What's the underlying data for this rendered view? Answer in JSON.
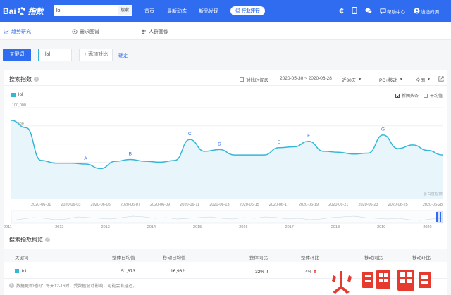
{
  "header": {
    "logo_text_left": "Bai",
    "logo_text_right": "指数",
    "search_value": "lol",
    "search_button": "搜索",
    "nav": [
      "首页",
      "最新动态",
      "新品发现"
    ],
    "rank_button": "行业排行",
    "tools": [
      {
        "icon": "share-icon",
        "label": ""
      },
      {
        "icon": "mobile-icon",
        "label": ""
      },
      {
        "icon": "wechat-icon",
        "label": ""
      },
      {
        "icon": "help-icon",
        "label": "帮助中心"
      },
      {
        "icon": "user-icon",
        "label": "浅浅的调"
      }
    ]
  },
  "subnav": {
    "items": [
      "趋势研究",
      "需求图谱",
      "人群画像"
    ]
  },
  "keyword_bar": {
    "keyword_button": "关键词",
    "keyword": "lol",
    "add_compare": "+ 添加对比",
    "confirm": "确定"
  },
  "chart_panel": {
    "title": "搜索指数",
    "compare_period": "对比时间段",
    "date_range": "2020-05-30 ~ 2020-06-28",
    "range_select": "近30天",
    "device_select": "PC+移动",
    "region_select": "全国",
    "news_label": "新闻头条",
    "avg_label": "平均值",
    "watermark": "@百度指数"
  },
  "chart_data": {
    "type": "area",
    "series": [
      {
        "name": "lol",
        "color": "#35b6d8"
      }
    ],
    "ylim": [
      0,
      100000
    ],
    "y_ticks": [
      "100,000",
      "80,000",
      "60,000",
      "40,000",
      "20,000"
    ],
    "x_tick_labels": [
      "2020-06-01",
      "2020-06-03",
      "2020-06-05",
      "2020-06-07",
      "2020-06-09",
      "2020-06-11",
      "2020-06-13",
      "2020-06-15",
      "2020-06-17",
      "2020-06-19",
      "2020-06-21",
      "2020-06-23",
      "2020-06-25",
      "2020-06-28"
    ],
    "x": [
      "2020-05-30",
      "2020-05-31",
      "2020-06-01",
      "2020-06-02",
      "2020-06-03",
      "2020-06-04",
      "2020-06-05",
      "2020-06-06",
      "2020-06-07",
      "2020-06-08",
      "2020-06-09",
      "2020-06-10",
      "2020-06-11",
      "2020-06-12",
      "2020-06-13",
      "2020-06-14",
      "2020-06-15",
      "2020-06-16",
      "2020-06-17",
      "2020-06-18",
      "2020-06-19",
      "2020-06-20",
      "2020-06-21",
      "2020-06-22",
      "2020-06-23",
      "2020-06-24",
      "2020-06-25",
      "2020-06-26",
      "2020-06-27",
      "2020-06-28"
    ],
    "values": [
      86000,
      78000,
      42000,
      39000,
      39000,
      38000,
      33000,
      41000,
      43000,
      41000,
      40000,
      42000,
      65000,
      52000,
      54000,
      48000,
      48000,
      48000,
      56000,
      57000,
      63000,
      52000,
      51000,
      49000,
      50000,
      70000,
      55000,
      59000,
      53000,
      48000
    ],
    "annotations": [
      {
        "label": "A",
        "x": "2020-06-04"
      },
      {
        "label": "B",
        "x": "2020-06-07"
      },
      {
        "label": "C",
        "x": "2020-06-11"
      },
      {
        "label": "D",
        "x": "2020-06-13"
      },
      {
        "label": "E",
        "x": "2020-06-17"
      },
      {
        "label": "F",
        "x": "2020-06-19"
      },
      {
        "label": "G",
        "x": "2020-06-24"
      },
      {
        "label": "H",
        "x": "2020-06-26"
      }
    ],
    "overview_years": [
      "2011",
      "2012",
      "2013",
      "2014",
      "2015",
      "2016",
      "2017",
      "2018",
      "2019",
      "2020"
    ]
  },
  "overview": {
    "title": "搜索指数概览",
    "headers": [
      "关键词",
      "整体日均值",
      "移动日均值",
      "整体同比",
      "整体环比",
      "移动同比",
      "移动环比"
    ],
    "row": {
      "keyword": "lol",
      "overall_avg": "51,873",
      "mobile_avg": "16,962",
      "overall_yoy": "-32%",
      "overall_mom": "4%"
    },
    "footer": "数据更新时间：每天12-16时，受数据波动影响，可能会有延迟。"
  },
  "brand_watermark": "火鲤鱼"
}
